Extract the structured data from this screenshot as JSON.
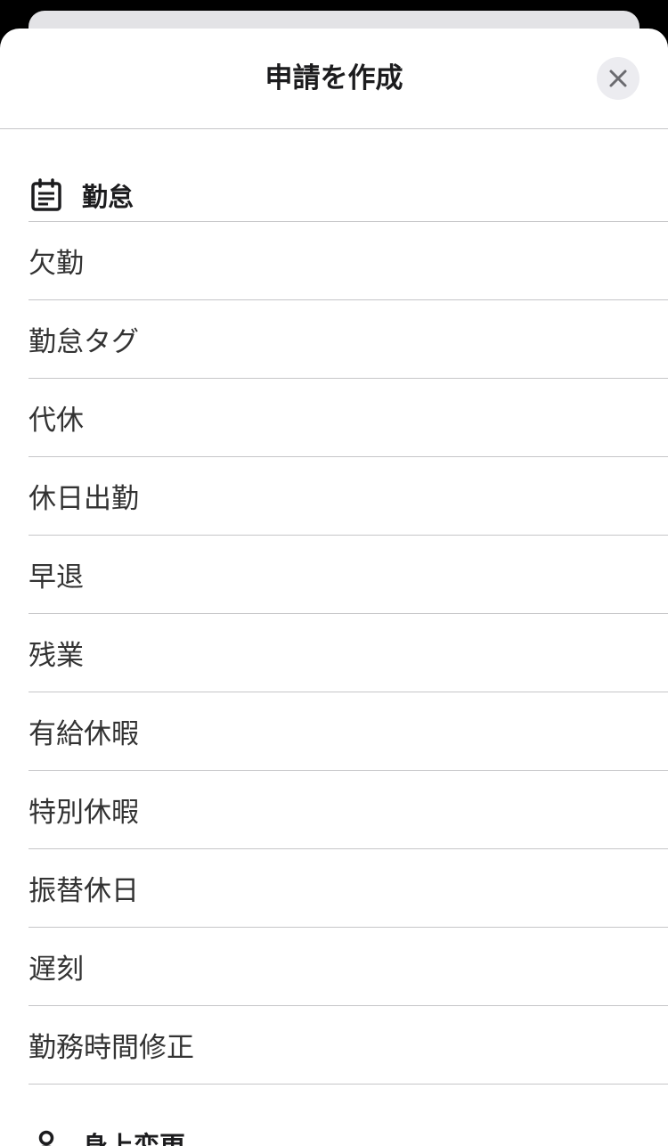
{
  "header": {
    "title": "申請を作成",
    "close_icon": "close-icon"
  },
  "sections": [
    {
      "icon": "calendar-note-icon",
      "title": "勤怠",
      "items": [
        "欠勤",
        "勤怠タグ",
        "代休",
        "休日出勤",
        "早退",
        "残業",
        "有給休暇",
        "特別休暇",
        "振替休日",
        "遅刻",
        "勤務時間修正"
      ]
    },
    {
      "icon": "person-icon",
      "title": "身上変更"
    }
  ],
  "colors": {
    "text": "#1c1c1e",
    "item_text": "#333333",
    "divider": "#c6c6c8",
    "close_bg": "#ececf0",
    "backdrop": "#000000"
  }
}
